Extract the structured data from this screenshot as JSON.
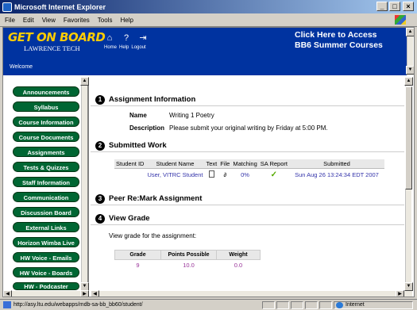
{
  "window": {
    "title": "Microsoft Internet Explorer"
  },
  "menu": [
    "File",
    "Edit",
    "View",
    "Favorites",
    "Tools",
    "Help"
  ],
  "banner": {
    "logo_line1": "GET ON BOARD",
    "logo_line2": "LAWRENCE TECH",
    "nav_labels": [
      "Home",
      "Help",
      "Logout"
    ],
    "access_line1": "Click Here to Access",
    "access_line2": "BB6 Summer Courses",
    "welcome": "Welcome"
  },
  "sidebar": {
    "items": [
      {
        "label": "Announcements"
      },
      {
        "label": "Syllabus"
      },
      {
        "label": "Course Information"
      },
      {
        "label": "Course Documents"
      },
      {
        "label": "Assignments"
      },
      {
        "label": "Tests & Quizzes"
      },
      {
        "label": "Staff Information"
      },
      {
        "label": "Communication"
      },
      {
        "label": "Discussion Board"
      },
      {
        "label": "External Links"
      },
      {
        "label": "Horizon Wimba Live"
      },
      {
        "label": "HW Voice - Emails"
      },
      {
        "label": "HW Voice - Boards"
      },
      {
        "label": "HW - Podcaster"
      }
    ]
  },
  "main": {
    "sections": [
      {
        "num": "1",
        "title": "Assignment Information"
      },
      {
        "num": "2",
        "title": "Submitted Work"
      },
      {
        "num": "3",
        "title": "Peer Re:Mark Assignment"
      },
      {
        "num": "4",
        "title": "View Grade"
      }
    ],
    "name_label": "Name",
    "name_value": "Writing 1 Poetry",
    "desc_label": "Description",
    "desc_value": "Please submit your original writing by Friday at 5:00 PM.",
    "submitted": {
      "headers": [
        "Student ID",
        "Student Name",
        "Text",
        "File",
        "Matching",
        "SA Report",
        "Submitted"
      ],
      "row": {
        "student_id": "",
        "student_name": "User, VITRC Student",
        "matching": "0%",
        "submitted": "Sun Aug 26 13:24:34 EDT 2007"
      }
    },
    "grade_intro": "View grade for the assignment:",
    "grade": {
      "headers": [
        "Grade",
        "Points Possible",
        "Weight"
      ],
      "values": [
        "9",
        "10.0",
        "0.0"
      ]
    }
  },
  "status": {
    "url": "http://asy.ltu.edu/webapps/mdb-sa-bb_bb60/student/",
    "zone": "Internet"
  }
}
